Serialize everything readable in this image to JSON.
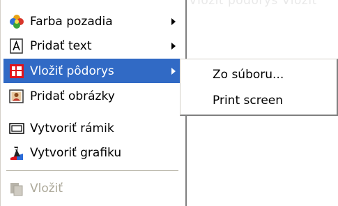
{
  "background_text": "Farba pozadia   Pridať text   Vložiť pôdorys   Vložiť",
  "context_menu": {
    "items": [
      {
        "label": "Farba pozadia",
        "icon": "palette-icon",
        "has_submenu": true
      },
      {
        "label": "Pridať text",
        "icon": "text-box-icon",
        "has_submenu": true
      },
      {
        "label": "Vložiť pôdorys",
        "icon": "floor-plan-icon",
        "has_submenu": true,
        "highlighted": true
      },
      {
        "label": "Pridať obrázky",
        "icon": "picture-icon",
        "has_submenu": false
      },
      {
        "label": "Vytvoriť rámik",
        "icon": "frame-icon",
        "has_submenu": false
      },
      {
        "label": "Vytvoriť grafiku",
        "icon": "graphics-icon",
        "has_submenu": false
      },
      {
        "label": "Vložiť",
        "icon": "paste-icon",
        "has_submenu": false,
        "disabled": true
      }
    ]
  },
  "submenu": {
    "items": [
      {
        "label": "Zo súboru..."
      },
      {
        "label": "Print screen"
      }
    ]
  },
  "colors": {
    "highlight": "#316ac5",
    "disabled_text": "#aca899"
  }
}
